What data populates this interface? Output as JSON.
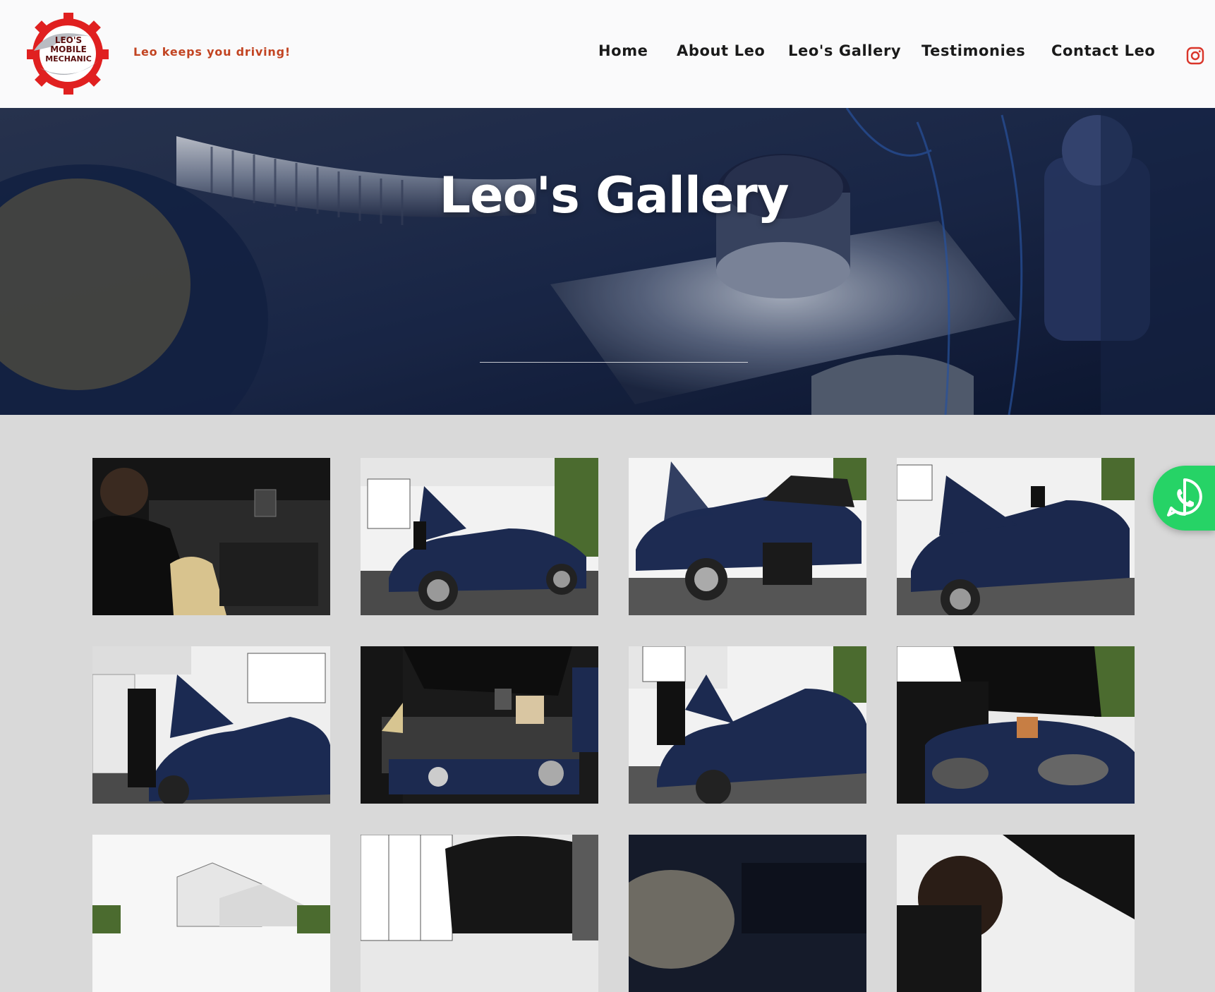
{
  "brand": {
    "logo_text": [
      "LEO'S",
      "MOBILE",
      "MECHANIC"
    ],
    "tagline": "Leo keeps you driving!"
  },
  "nav": {
    "items": [
      {
        "label": "Home"
      },
      {
        "label": "About Leo"
      },
      {
        "label": "Leo's Gallery"
      },
      {
        "label": "Testimonies"
      },
      {
        "label": "Contact Leo"
      }
    ],
    "social_icon": "instagram-icon"
  },
  "hero": {
    "title": "Leo's Gallery"
  },
  "gallery": {
    "rows": 3,
    "columns": 4,
    "photo_count": 12
  },
  "whatsapp": {
    "icon": "whatsapp-icon"
  },
  "colors": {
    "tagline": "#c24422",
    "logo_red": "#e02020",
    "header_bg": "#fafafb",
    "page_bg": "#d9d9d9",
    "whatsapp": "#26d366"
  }
}
